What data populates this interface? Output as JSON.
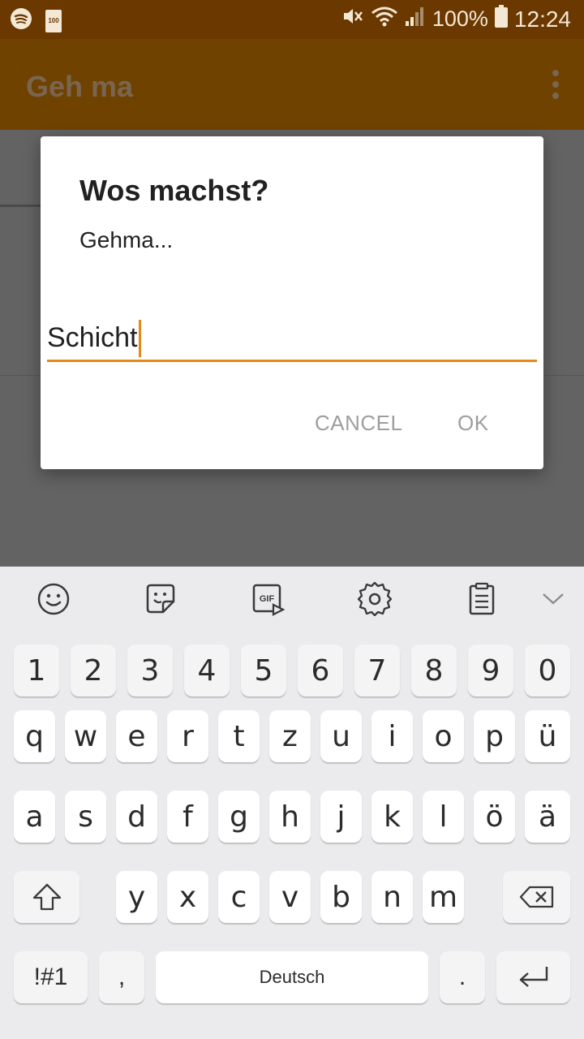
{
  "status_bar": {
    "left_icons": [
      "spotify-icon",
      "battery-saver-icon"
    ],
    "battery_saver_label": "100",
    "battery_percent": "100%",
    "time": "12:24",
    "right_icons": [
      "mute-icon",
      "wifi-icon",
      "signal-icon",
      "battery-icon"
    ]
  },
  "app_bar": {
    "title": "Geh ma",
    "overflow_icon": "more-vert-icon"
  },
  "dialog": {
    "title": "Wos machst?",
    "message": "Gehma...",
    "input_value": "Schicht",
    "cancel_label": "CANCEL",
    "ok_label": "OK",
    "accent_color": "#e08a1a"
  },
  "keyboard": {
    "toolbar": [
      "emoji-icon",
      "sticker-icon",
      "gif-icon",
      "settings-icon",
      "clipboard-icon",
      "collapse-icon"
    ],
    "gif_label": "GIF",
    "row_numbers": [
      "1",
      "2",
      "3",
      "4",
      "5",
      "6",
      "7",
      "8",
      "9",
      "0"
    ],
    "row_1": [
      "q",
      "w",
      "e",
      "r",
      "t",
      "z",
      "u",
      "i",
      "o",
      "p",
      "ü"
    ],
    "row_2": [
      "a",
      "s",
      "d",
      "f",
      "g",
      "h",
      "j",
      "k",
      "l",
      "ö",
      "ä"
    ],
    "row_3": [
      "y",
      "x",
      "c",
      "v",
      "b",
      "n",
      "m"
    ],
    "symbols_label": "!#1",
    "comma_label": ",",
    "space_label": "Deutsch",
    "period_label": "."
  }
}
